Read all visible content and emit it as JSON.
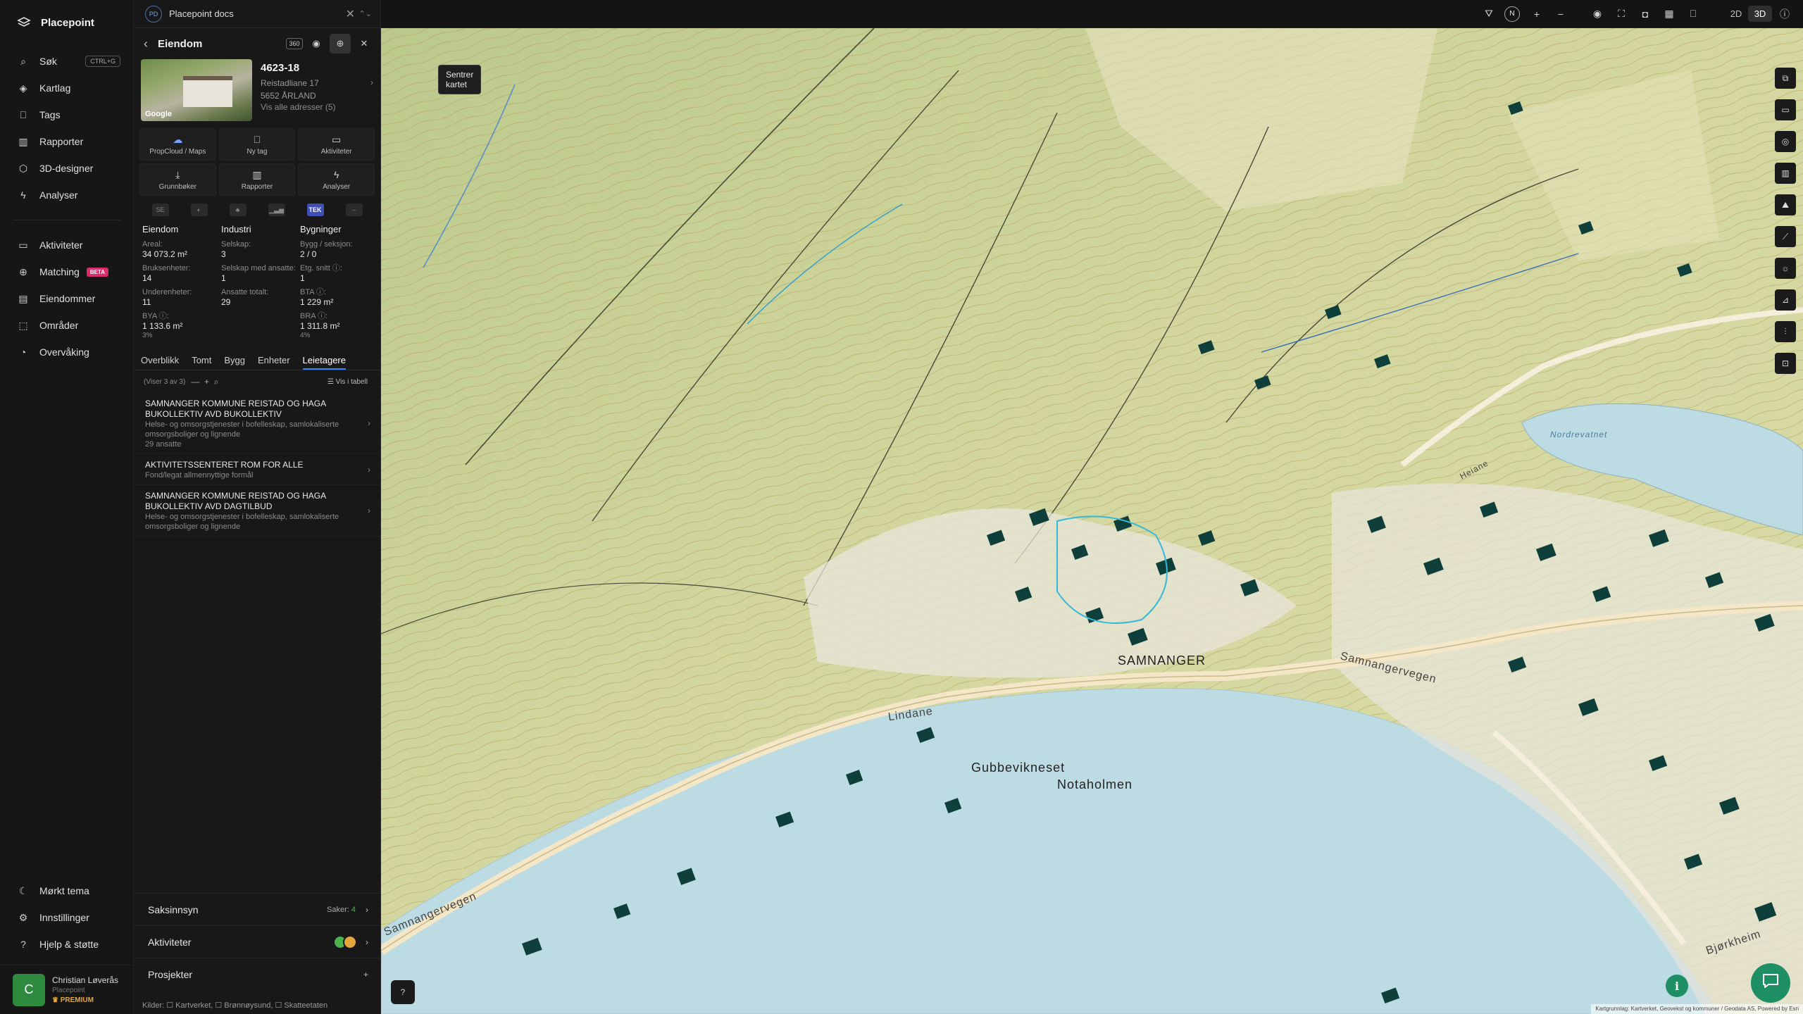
{
  "app": {
    "name": "Placepoint"
  },
  "nav": {
    "items": [
      {
        "label": "Søk",
        "icon": "search-icon",
        "shortcut": "CTRL+G"
      },
      {
        "label": "Kartlag",
        "icon": "layers-icon"
      },
      {
        "label": "Tags",
        "icon": "bookmark-icon"
      },
      {
        "label": "Rapporter",
        "icon": "bar-chart-icon"
      },
      {
        "label": "3D-designer",
        "icon": "cube-icon"
      },
      {
        "label": "Analyser",
        "icon": "bolt-icon"
      }
    ],
    "items2": [
      {
        "label": "Aktiviteter",
        "icon": "chat-icon"
      },
      {
        "label": "Matching",
        "icon": "match-icon",
        "badge": "BETA"
      },
      {
        "label": "Eiendommer",
        "icon": "building-icon"
      },
      {
        "label": "Områder",
        "icon": "area-icon"
      },
      {
        "label": "Overvåking",
        "icon": "monitor-icon"
      }
    ],
    "bottom": [
      {
        "label": "Mørkt tema",
        "icon": "moon-icon"
      },
      {
        "label": "Innstillinger",
        "icon": "gear-icon"
      },
      {
        "label": "Hjelp & støtte",
        "icon": "help-icon"
      }
    ],
    "user": {
      "initial": "C",
      "name": "Christian Løverås",
      "org": "Placepoint",
      "plan": "PREMIUM"
    }
  },
  "panel": {
    "doc_badge": "PD",
    "doc_title": "Placepoint docs",
    "title": "Eiendom",
    "tooltip": "Sentrer kartet",
    "property": {
      "id": "4623-18",
      "address": "Reistadliane 17",
      "postal": "5652 ÅRLAND",
      "all_addresses": "Vis alle adresser (5)",
      "photo_label": "Google"
    },
    "actions": [
      {
        "label": "PropCloud / Maps",
        "icon": "cloud-icon"
      },
      {
        "label": "Ny tag",
        "icon": "bookmark-icon"
      },
      {
        "label": "Aktiviteter",
        "icon": "chat-icon"
      },
      {
        "label": "Grunnbøker",
        "icon": "download-icon"
      },
      {
        "label": "Rapporter",
        "icon": "bar-chart-icon"
      },
      {
        "label": "Analyser",
        "icon": "bolt-icon"
      }
    ],
    "datasources": [
      "SE",
      "",
      "",
      "",
      "TEK",
      ""
    ],
    "stats": {
      "eiendom": {
        "header": "Eiendom",
        "areal_label": "Areal:",
        "areal": "34 073.2 m²",
        "bruks_label": "Bruksenheter:",
        "bruks": "14",
        "under_label": "Underenheter:",
        "under": "11",
        "bya_label": "BYA ⓘ:",
        "bya": "1 133.6 m²",
        "bya_pct": "3%"
      },
      "industri": {
        "header": "Industri",
        "selskap_label": "Selskap:",
        "selskap": "3",
        "ansatte_label": "Selskap med ansatte:",
        "ansatte": "1",
        "totalt_label": "Ansatte totalt:",
        "totalt": "29"
      },
      "bygninger": {
        "header": "Bygninger",
        "bygg_label": "Bygg / seksjon:",
        "bygg": "2 / 0",
        "etg_label": "Etg. snitt ⓘ:",
        "etg": "1",
        "bta_label": "BTA ⓘ:",
        "bta": "1 229 m²",
        "bra_label": "BRA ⓘ:",
        "bra": "1 311.8 m²",
        "bra_pct": "4%"
      }
    },
    "tabs": [
      "Overblikk",
      "Tomt",
      "Bygg",
      "Enheter",
      "Leietagere"
    ],
    "active_tab": "Leietagere",
    "list": {
      "count": "(Viser 3 av 3)",
      "table_btn": "Vis i tabell"
    },
    "tenants": [
      {
        "name": "SAMNANGER KOMMUNE REISTAD OG HAGA BUKOLLEKTIV AVD BUKOLLEKTIV",
        "desc": "Helse- og omsorgstjenester i bofelleskap, samlokaliserte omsorgsboliger og lignende",
        "count": "29 ansatte"
      },
      {
        "name": "AKTIVITETSSENTERET ROM FOR ALLE",
        "desc": "Fond/legat allmennyttige formål",
        "count": ""
      },
      {
        "name": "SAMNANGER KOMMUNE REISTAD OG HAGA BUKOLLEKTIV AVD DAGTILBUD",
        "desc": "Helse- og omsorgstjenester i bofelleskap, samlokaliserte omsorgsboliger og lignende",
        "count": ""
      }
    ],
    "sections": {
      "saksinnsyn": "Saksinnsyn",
      "saker_label": "Saker:",
      "saker": "4",
      "aktiviteter": "Aktiviteter",
      "prosjekter": "Prosjekter"
    },
    "sources": "Kilder: ☐ Kartverket, ☐ Brønnøysund, ☐ Skatteetaten"
  },
  "map": {
    "mode_2d": "2D",
    "mode_3d": "3D",
    "active_mode": "3D",
    "compass": "N",
    "labels": {
      "samnanger": "SAMNANGER",
      "gubbevikneset": "Gubbevikneset",
      "notaholmen": "Notaholmen",
      "lindane": "Lindane",
      "samnangervegen_left": "Samnangervegen",
      "samnangervegen_right": "Samnangervegen",
      "bjorkheim": "Bjørkheim",
      "nordrevatnet": "Nordrevatnet",
      "heiane": "Heiane"
    },
    "attribution": "Kartgrunnlag: Kartverket, Geovekst og kommuner / Geodata AS, Powered by Esri",
    "colors": {
      "terrain": "#cfd69d",
      "water": "#bcdbe3",
      "contour": "#b69a5a",
      "building": "#0f3f3a",
      "accent": "#1e8f64"
    }
  }
}
